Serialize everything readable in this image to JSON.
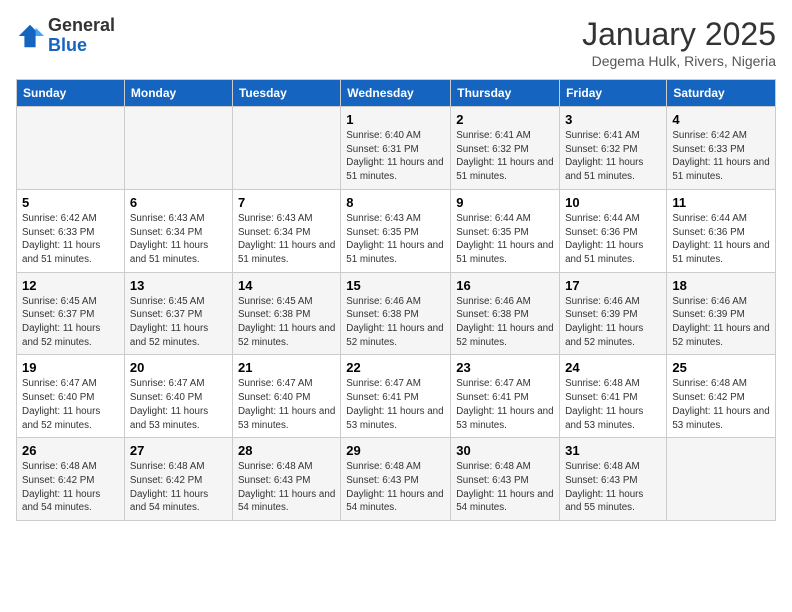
{
  "logo": {
    "general": "General",
    "blue": "Blue"
  },
  "header": {
    "title": "January 2025",
    "subtitle": "Degema Hulk, Rivers, Nigeria"
  },
  "days_of_week": [
    "Sunday",
    "Monday",
    "Tuesday",
    "Wednesday",
    "Thursday",
    "Friday",
    "Saturday"
  ],
  "weeks": [
    [
      {
        "day": "",
        "info": ""
      },
      {
        "day": "",
        "info": ""
      },
      {
        "day": "",
        "info": ""
      },
      {
        "day": "1",
        "info": "Sunrise: 6:40 AM\nSunset: 6:31 PM\nDaylight: 11 hours and 51 minutes."
      },
      {
        "day": "2",
        "info": "Sunrise: 6:41 AM\nSunset: 6:32 PM\nDaylight: 11 hours and 51 minutes."
      },
      {
        "day": "3",
        "info": "Sunrise: 6:41 AM\nSunset: 6:32 PM\nDaylight: 11 hours and 51 minutes."
      },
      {
        "day": "4",
        "info": "Sunrise: 6:42 AM\nSunset: 6:33 PM\nDaylight: 11 hours and 51 minutes."
      }
    ],
    [
      {
        "day": "5",
        "info": "Sunrise: 6:42 AM\nSunset: 6:33 PM\nDaylight: 11 hours and 51 minutes."
      },
      {
        "day": "6",
        "info": "Sunrise: 6:43 AM\nSunset: 6:34 PM\nDaylight: 11 hours and 51 minutes."
      },
      {
        "day": "7",
        "info": "Sunrise: 6:43 AM\nSunset: 6:34 PM\nDaylight: 11 hours and 51 minutes."
      },
      {
        "day": "8",
        "info": "Sunrise: 6:43 AM\nSunset: 6:35 PM\nDaylight: 11 hours and 51 minutes."
      },
      {
        "day": "9",
        "info": "Sunrise: 6:44 AM\nSunset: 6:35 PM\nDaylight: 11 hours and 51 minutes."
      },
      {
        "day": "10",
        "info": "Sunrise: 6:44 AM\nSunset: 6:36 PM\nDaylight: 11 hours and 51 minutes."
      },
      {
        "day": "11",
        "info": "Sunrise: 6:44 AM\nSunset: 6:36 PM\nDaylight: 11 hours and 51 minutes."
      }
    ],
    [
      {
        "day": "12",
        "info": "Sunrise: 6:45 AM\nSunset: 6:37 PM\nDaylight: 11 hours and 52 minutes."
      },
      {
        "day": "13",
        "info": "Sunrise: 6:45 AM\nSunset: 6:37 PM\nDaylight: 11 hours and 52 minutes."
      },
      {
        "day": "14",
        "info": "Sunrise: 6:45 AM\nSunset: 6:38 PM\nDaylight: 11 hours and 52 minutes."
      },
      {
        "day": "15",
        "info": "Sunrise: 6:46 AM\nSunset: 6:38 PM\nDaylight: 11 hours and 52 minutes."
      },
      {
        "day": "16",
        "info": "Sunrise: 6:46 AM\nSunset: 6:38 PM\nDaylight: 11 hours and 52 minutes."
      },
      {
        "day": "17",
        "info": "Sunrise: 6:46 AM\nSunset: 6:39 PM\nDaylight: 11 hours and 52 minutes."
      },
      {
        "day": "18",
        "info": "Sunrise: 6:46 AM\nSunset: 6:39 PM\nDaylight: 11 hours and 52 minutes."
      }
    ],
    [
      {
        "day": "19",
        "info": "Sunrise: 6:47 AM\nSunset: 6:40 PM\nDaylight: 11 hours and 52 minutes."
      },
      {
        "day": "20",
        "info": "Sunrise: 6:47 AM\nSunset: 6:40 PM\nDaylight: 11 hours and 53 minutes."
      },
      {
        "day": "21",
        "info": "Sunrise: 6:47 AM\nSunset: 6:40 PM\nDaylight: 11 hours and 53 minutes."
      },
      {
        "day": "22",
        "info": "Sunrise: 6:47 AM\nSunset: 6:41 PM\nDaylight: 11 hours and 53 minutes."
      },
      {
        "day": "23",
        "info": "Sunrise: 6:47 AM\nSunset: 6:41 PM\nDaylight: 11 hours and 53 minutes."
      },
      {
        "day": "24",
        "info": "Sunrise: 6:48 AM\nSunset: 6:41 PM\nDaylight: 11 hours and 53 minutes."
      },
      {
        "day": "25",
        "info": "Sunrise: 6:48 AM\nSunset: 6:42 PM\nDaylight: 11 hours and 53 minutes."
      }
    ],
    [
      {
        "day": "26",
        "info": "Sunrise: 6:48 AM\nSunset: 6:42 PM\nDaylight: 11 hours and 54 minutes."
      },
      {
        "day": "27",
        "info": "Sunrise: 6:48 AM\nSunset: 6:42 PM\nDaylight: 11 hours and 54 minutes."
      },
      {
        "day": "28",
        "info": "Sunrise: 6:48 AM\nSunset: 6:43 PM\nDaylight: 11 hours and 54 minutes."
      },
      {
        "day": "29",
        "info": "Sunrise: 6:48 AM\nSunset: 6:43 PM\nDaylight: 11 hours and 54 minutes."
      },
      {
        "day": "30",
        "info": "Sunrise: 6:48 AM\nSunset: 6:43 PM\nDaylight: 11 hours and 54 minutes."
      },
      {
        "day": "31",
        "info": "Sunrise: 6:48 AM\nSunset: 6:43 PM\nDaylight: 11 hours and 55 minutes."
      },
      {
        "day": "",
        "info": ""
      }
    ]
  ]
}
